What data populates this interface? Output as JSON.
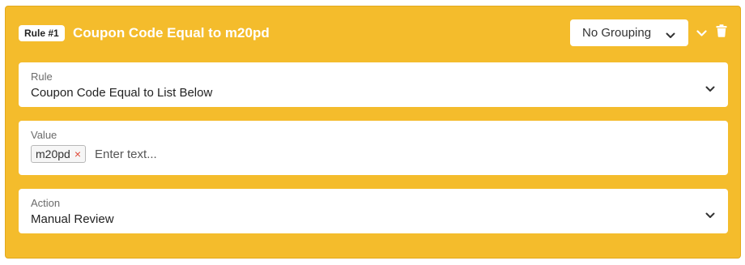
{
  "rule_card": {
    "badge": "Rule #1",
    "title": "Coupon Code Equal to m20pd",
    "grouping": {
      "selected": "No Grouping"
    }
  },
  "fields": {
    "rule": {
      "label": "Rule",
      "value": "Coupon Code Equal to List Below"
    },
    "value": {
      "label": "Value",
      "tags": [
        "m20pd"
      ],
      "placeholder": "Enter text..."
    },
    "action": {
      "label": "Action",
      "value": "Manual Review"
    }
  },
  "colors": {
    "card": "#f4bc2c",
    "remove_tag": "#e04a3a"
  },
  "icons": [
    "chevron-down-icon",
    "collapse-chevron-icon",
    "trash-icon",
    "remove-tag-icon"
  ]
}
